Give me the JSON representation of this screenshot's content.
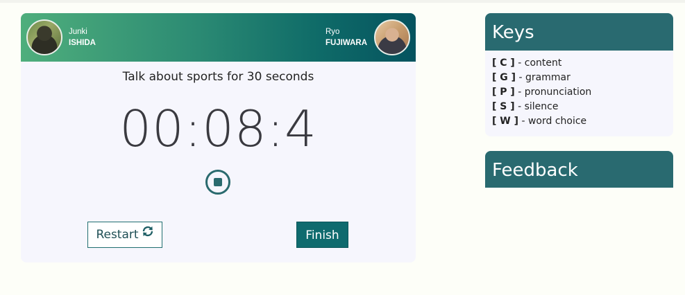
{
  "session": {
    "student": {
      "first_name": "Junki",
      "last_name": "ISHIDA"
    },
    "teacher": {
      "first_name": "Ryo",
      "last_name": "FUJIWARA"
    },
    "prompt": "Talk about sports for 30 seconds",
    "timer": "00:08:4",
    "restart_label": "Restart",
    "finish_label": "Finish",
    "icons": {
      "stop": "stop-circle-icon",
      "restart": "refresh-icon"
    }
  },
  "keys": {
    "title": "Keys",
    "items": [
      {
        "code": "[ C ]",
        "desc": " - content"
      },
      {
        "code": "[ G ]",
        "desc": " - grammar"
      },
      {
        "code": "[ P ]",
        "desc": " - pronunciation"
      },
      {
        "code": "[ S ]",
        "desc": " - silence"
      },
      {
        "code": "[ W ]",
        "desc": " - word choice"
      }
    ]
  },
  "feedback": {
    "title": "Feedback"
  },
  "colors": {
    "accent": "#296a70",
    "finish_button": "#0f6b6e",
    "header_gradient_start": "#4fae7c",
    "header_gradient_end": "#05535f"
  }
}
